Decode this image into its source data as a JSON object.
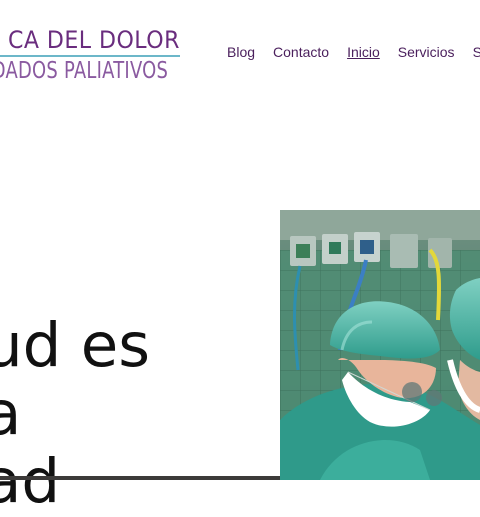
{
  "header": {
    "logo_line1": "CA DEL DOLOR",
    "logo_line2": "DADOS PALIATIVOS"
  },
  "nav": {
    "items": [
      {
        "label": "Blog"
      },
      {
        "label": "Contacto"
      },
      {
        "label": "Inicio",
        "active": true
      },
      {
        "label": "Servicios"
      },
      {
        "label": "S"
      }
    ]
  },
  "hero": {
    "lines": [
      "ud es",
      "a",
      "ad"
    ]
  },
  "colors": {
    "brand_purple": "#6a2d7e",
    "accent_teal": "#6cb7c9",
    "nav_text": "#4a1f5c",
    "scrub_green": "#3aa898"
  },
  "image": {
    "subject": "surgeons in operating room"
  }
}
